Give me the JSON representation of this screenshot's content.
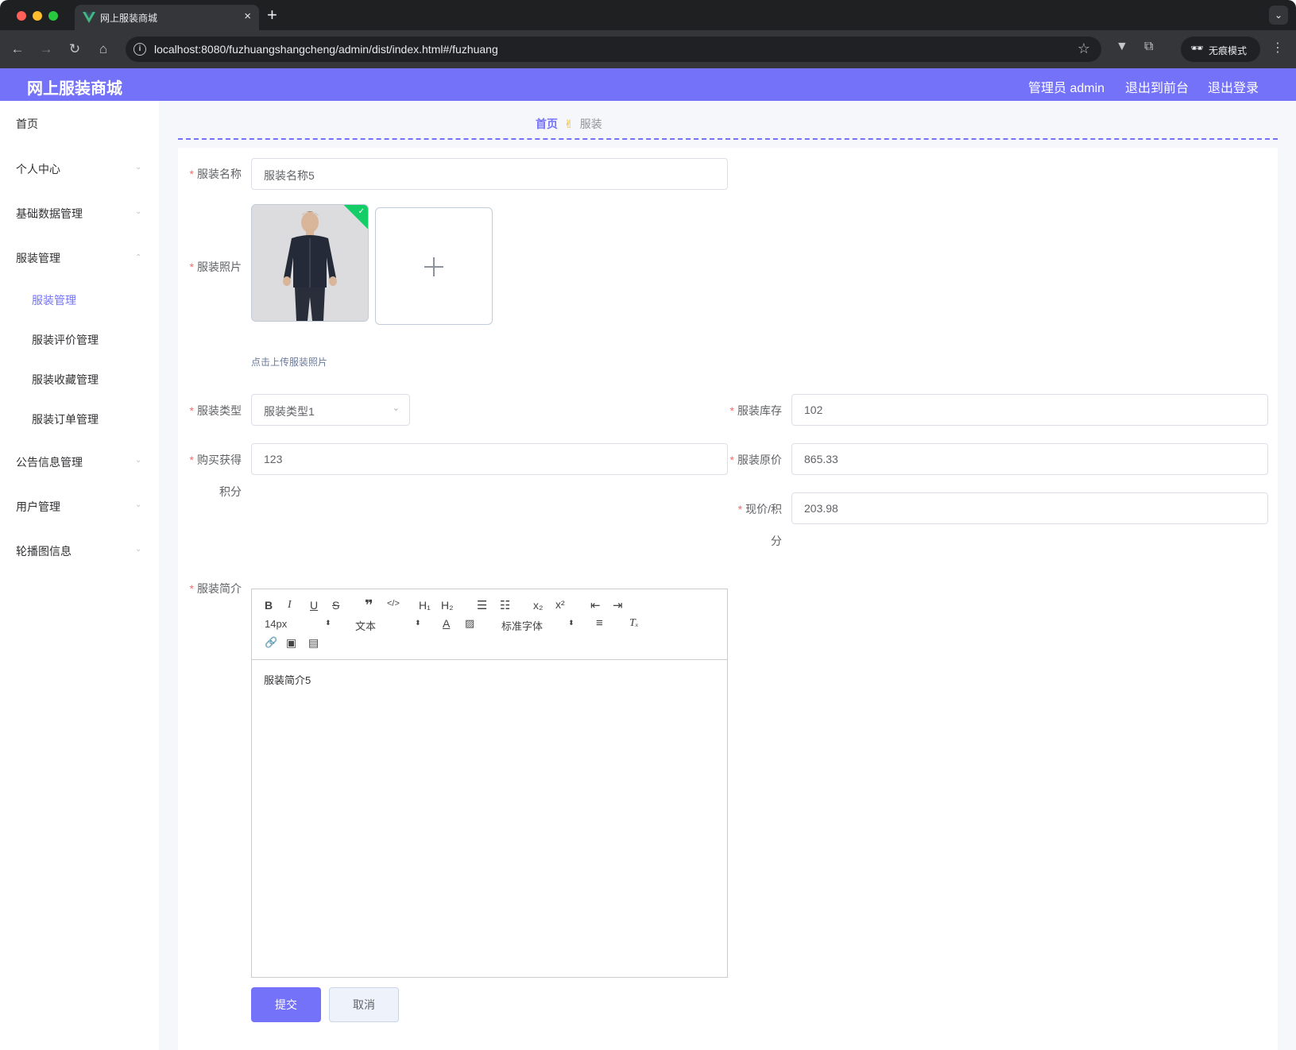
{
  "browser": {
    "tab_title": "网上服装商城",
    "tab_close": "×",
    "new_tab": "+",
    "url": "localhost:8080/fuzhuangshangcheng/admin/dist/index.html#/fuzhuang",
    "incognito_label": "无痕模式",
    "icons": [
      "back-arrow-icon",
      "forward-arrow-icon",
      "reload-icon",
      "home-icon",
      "info-icon",
      "star-icon",
      "vue-devtools-icon",
      "extensions-icon",
      "incognito-icon",
      "kebab-menu-icon"
    ]
  },
  "header": {
    "title": "网上服装商城",
    "admin_label": "管理员 admin",
    "front_link": "退出到前台",
    "logout_link": "退出登录",
    "accent_color": "#7472f8"
  },
  "sidebar": {
    "items": [
      {
        "label": "首页"
      },
      {
        "label": "个人中心"
      },
      {
        "label": "基础数据管理"
      },
      {
        "label": "服装管理"
      },
      {
        "label": "公告信息管理"
      },
      {
        "label": "用户管理"
      },
      {
        "label": "轮播图信息"
      }
    ],
    "sub_items": [
      {
        "label": "服装管理",
        "active": true
      },
      {
        "label": "服装评价管理"
      },
      {
        "label": "服装收藏管理"
      },
      {
        "label": "服装订单管理"
      }
    ]
  },
  "breadcrumb": {
    "home": "首页",
    "separator": "✌",
    "current": "服装"
  },
  "form": {
    "required_mark": "*",
    "name": {
      "label": "服装名称",
      "value": "服装名称5"
    },
    "photo": {
      "label": "服装照片",
      "tip": "点击上传服装照片"
    },
    "type": {
      "label": "服装类型",
      "value": "服装类型1"
    },
    "stock": {
      "label": "服装库存",
      "value": "102"
    },
    "points": {
      "label_line1": "购买获得",
      "label_line2": "积分",
      "value": "123"
    },
    "original_price": {
      "label": "服装原价",
      "value": "865.33"
    },
    "current_price": {
      "label_line1": "现价/积",
      "label_line2": "分",
      "value": "203.98"
    },
    "intro": {
      "label": "服装简介",
      "content": "服装简介5"
    },
    "submit_label": "提交",
    "cancel_label": "取消"
  },
  "editor": {
    "font_size": "14px",
    "block_format": "文本",
    "font_family": "标准字体",
    "buttons": {
      "bold": "B",
      "italic": "I",
      "underline": "U",
      "strike": "S",
      "h1": "H₁",
      "h2": "H₂",
      "sub": "x₂",
      "sup": "x²",
      "clean": "Tₓ"
    }
  }
}
